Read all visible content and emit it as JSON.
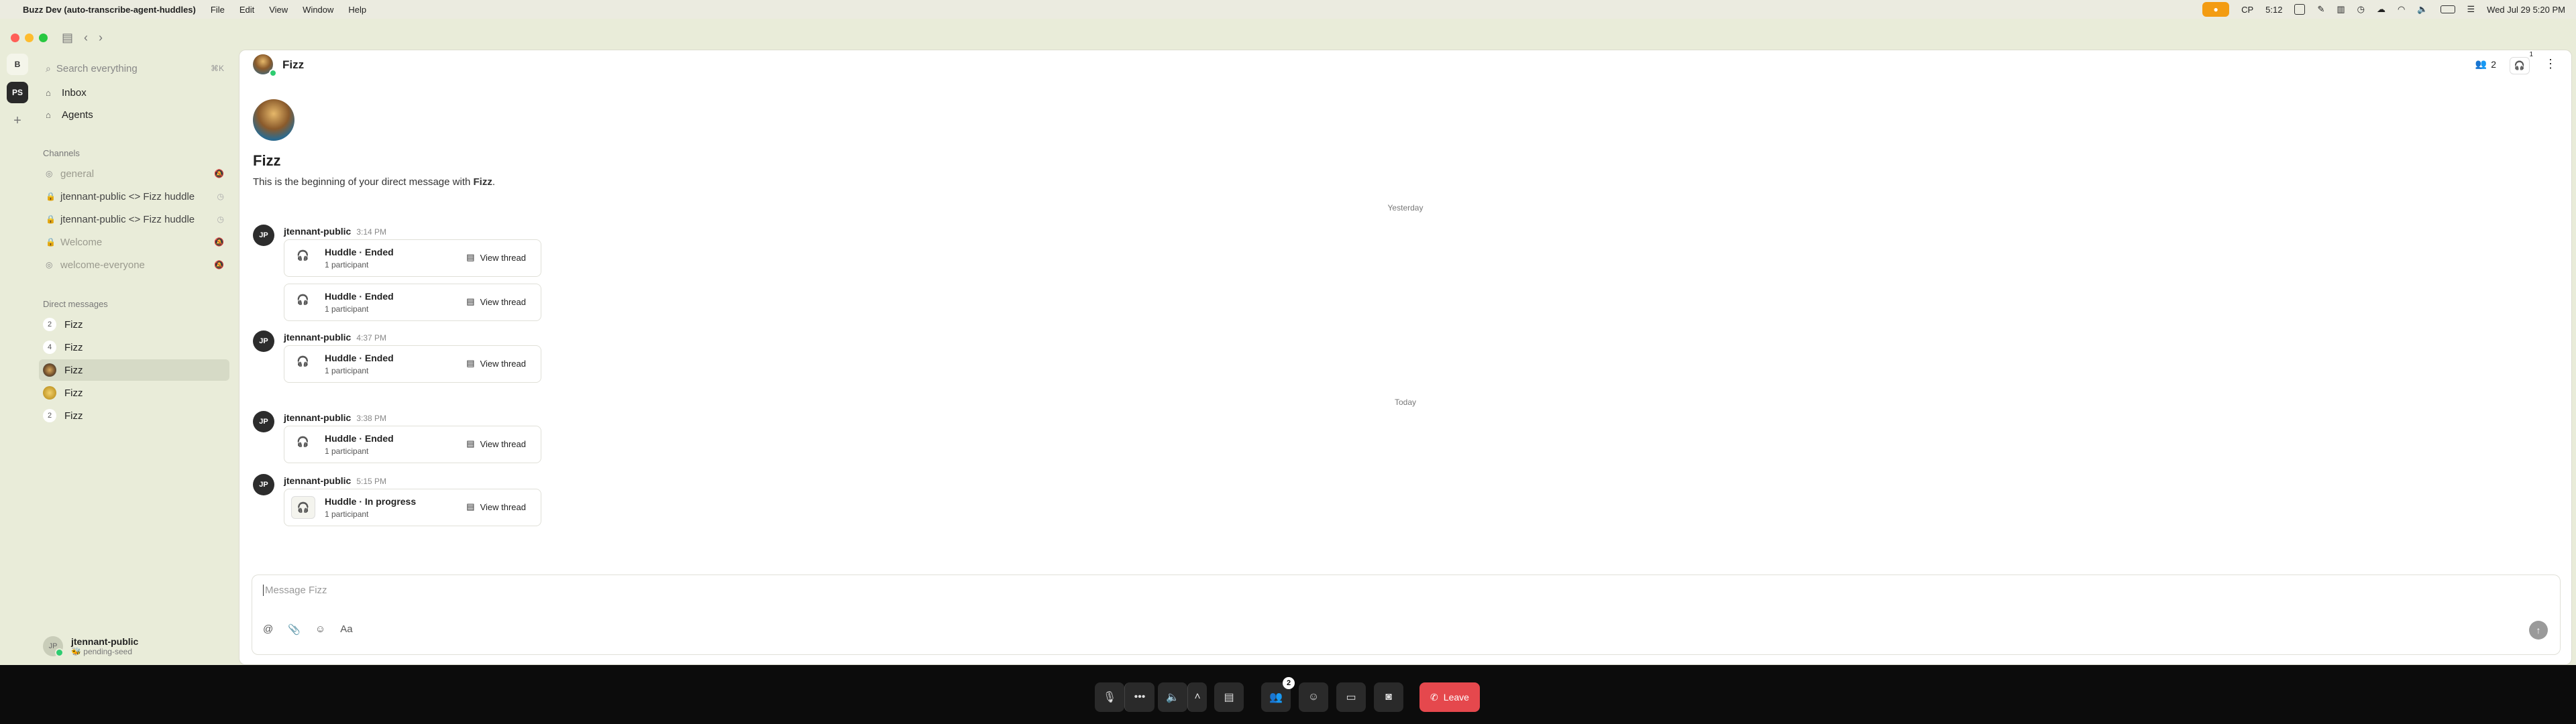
{
  "menubar": {
    "app_name": "Buzz Dev (auto-transcribe-agent-huddles)",
    "menus": [
      "File",
      "Edit",
      "View",
      "Window",
      "Help"
    ],
    "status_time": "5:12",
    "status_cp": "CP",
    "clock": "Wed Jul 29  5:20 PM"
  },
  "rail": {
    "workspace_b": "B",
    "workspace_ps": "PS",
    "add": "+"
  },
  "sidebar": {
    "search_placeholder": "Search everything",
    "search_shortcut": "⌘K",
    "nav": [
      {
        "label": "Inbox",
        "icon": "inbox-icon"
      },
      {
        "label": "Agents",
        "icon": "agents-icon"
      }
    ],
    "channels_title": "Channels",
    "channels": [
      {
        "label": "general",
        "icon": "hash-icon",
        "muted": true
      },
      {
        "label": "jtennant-public <> Fizz huddle",
        "icon": "lock-icon",
        "muted": false
      },
      {
        "label": "jtennant-public <> Fizz huddle",
        "icon": "lock-icon",
        "muted": false
      },
      {
        "label": "Welcome",
        "icon": "lock-icon",
        "muted": true
      },
      {
        "label": "welcome-everyone",
        "icon": "hash-icon",
        "muted": true
      }
    ],
    "dm_title": "Direct messages",
    "dms": [
      {
        "badge": "2",
        "label": "Fizz",
        "active": false
      },
      {
        "badge": "4",
        "label": "Fizz",
        "active": false
      },
      {
        "badge": "",
        "label": "Fizz",
        "active": true
      },
      {
        "badge": "",
        "label": "Fizz",
        "active": false
      },
      {
        "badge": "2",
        "label": "Fizz",
        "active": false
      }
    ],
    "user": {
      "initials": "JP",
      "name": "jtennant-public",
      "status": "🐝 pending-seed"
    }
  },
  "header": {
    "title": "Fizz",
    "members_count": "2",
    "huddle_badge": "1"
  },
  "intro": {
    "name": "Fizz",
    "text_prefix": "This is the beginning of your direct message with ",
    "text_name": "Fizz",
    "text_suffix": "."
  },
  "day_separators": [
    "Yesterday",
    "Today"
  ],
  "messages": [
    {
      "author": "jtennant-public",
      "initials": "JP",
      "time": "3:14 PM"
    },
    {
      "author": "jtennant-public",
      "initials": "JP",
      "time": "4:37 PM"
    },
    {
      "author": "jtennant-public",
      "initials": "JP",
      "time": "3:38 PM"
    },
    {
      "author": "jtennant-public",
      "initials": "JP",
      "time": "5:15 PM"
    }
  ],
  "cards": [
    {
      "title": "Huddle · Ended",
      "sub": "1 participant",
      "action": "View thread"
    },
    {
      "title": "Huddle · Ended",
      "sub": "1 participant",
      "action": "View thread"
    },
    {
      "title": "Huddle · Ended",
      "sub": "1 participant",
      "action": "View thread"
    },
    {
      "title": "Huddle · Ended",
      "sub": "1 participant",
      "action": "View thread"
    },
    {
      "title": "Huddle · In progress",
      "sub": "1 participant",
      "action": "View thread"
    }
  ],
  "composer": {
    "placeholder": "Message Fizz",
    "format_label": "Aa"
  },
  "callbar": {
    "participants_badge": "2",
    "leave_label": "Leave"
  }
}
